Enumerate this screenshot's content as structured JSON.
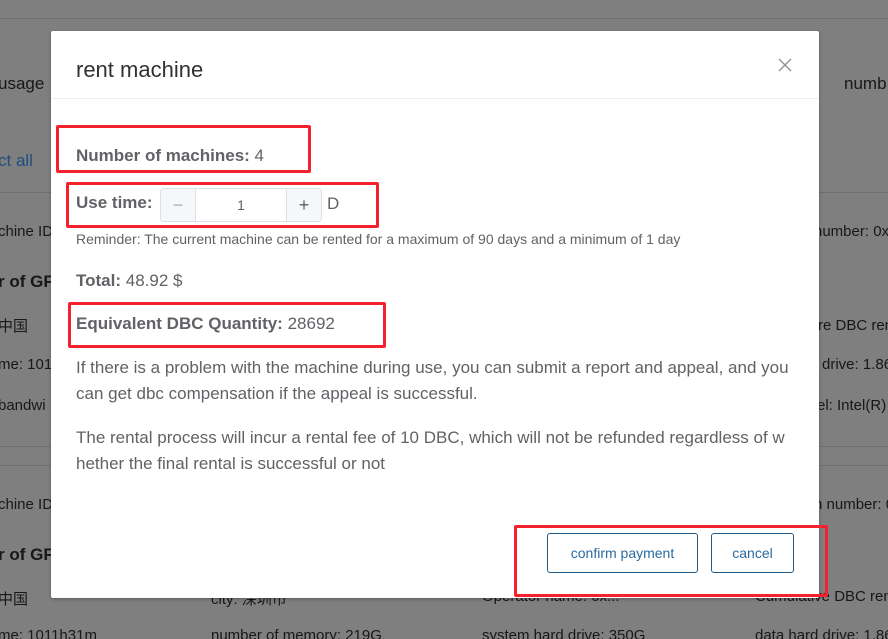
{
  "background": {
    "header_left": "usage",
    "header_right": "numb",
    "select_all": "ct all",
    "rows": [
      {
        "left": "chine ID",
        "right": "number: 0x"
      },
      {
        "left": "r of GF",
        "right": ""
      },
      {
        "left": "中国",
        "right": "re DBC ren"
      },
      {
        "left": "me: 1011",
        "right": "drive: 1.86"
      },
      {
        "left": "bandwi",
        "right": "el: Intel(R)"
      },
      {
        "left": "chine ID",
        "right": "n number: 0"
      },
      {
        "left": "r of GF",
        "right": ""
      },
      {
        "left": "中国",
        "c2": "city: 深圳市",
        "c3": "Operator name: 0x...",
        "right": "Cumulative DBC ren"
      },
      {
        "left": "me: 1011h31m",
        "c2": "number of memory: 219G",
        "c3": "system hard drive: 350G",
        "right": "data hard drive: 1.86"
      }
    ]
  },
  "dialog": {
    "title": "rent machine",
    "close_icon": "close-icon",
    "machines_label": "Number of machines:",
    "machines_value": "4",
    "use_time_label": "Use time:",
    "stepper": {
      "value": "1",
      "minus": "−",
      "plus": "+"
    },
    "unit": "D",
    "reminder": "Reminder: The current machine can be rented for a maximum of 90 days and a minimum of 1 day",
    "total_label": "Total:",
    "total_value": "48.92 $",
    "dbc_label": "Equivalent DBC Quantity:",
    "dbc_value": "28692",
    "para1": "If there is a problem with the machine during use, you can submit a report and appeal, and you can get dbc compensation if the appeal is successful.",
    "para2": "The rental process will incur a rental fee of 10 DBC, which will not be refunded regardless of whether the final rental is successful or not",
    "confirm_label": "confirm payment",
    "cancel_label": "cancel"
  },
  "colors": {
    "overlay": "#808080",
    "annotation": "#f5222d",
    "button_border": "#1f5c8a"
  }
}
